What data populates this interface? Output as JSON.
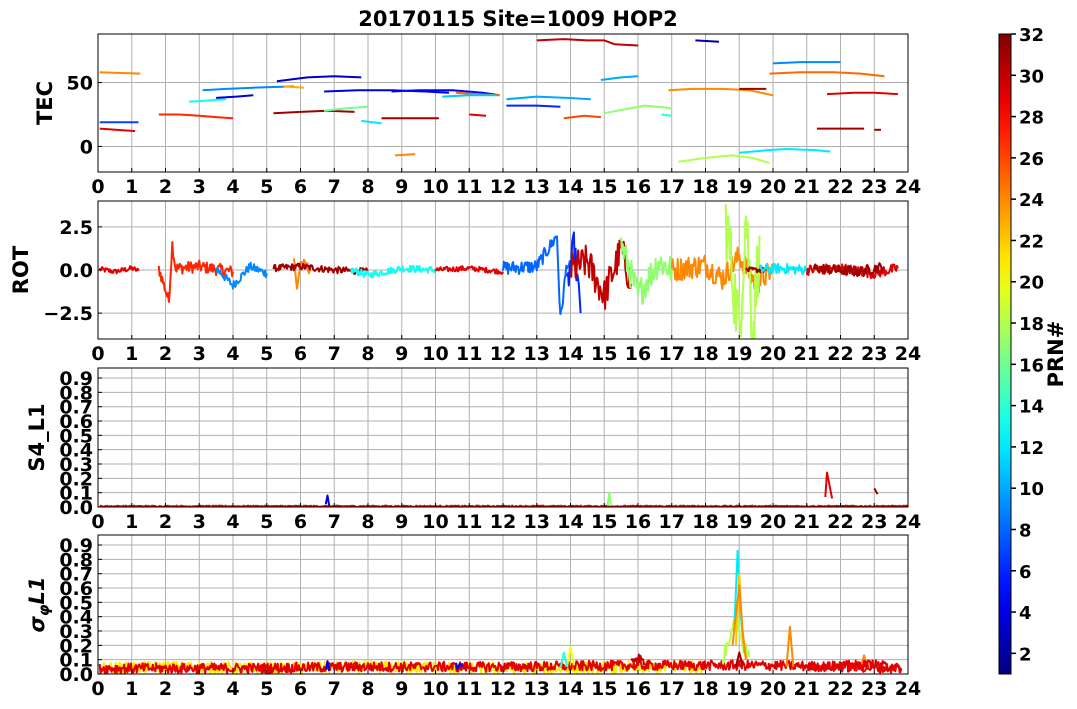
{
  "title": "20170115 Site=1009 HOP2",
  "colorbar": {
    "label": "PRN#",
    "colormap": "jet",
    "range": [
      1,
      32
    ],
    "ticks": [
      2,
      4,
      6,
      8,
      10,
      12,
      14,
      16,
      18,
      20,
      22,
      24,
      26,
      28,
      30,
      32
    ]
  },
  "chart_data": [
    {
      "type": "line",
      "ylabel": "TEC",
      "xlim": [
        0,
        24
      ],
      "ylim": [
        -20,
        88
      ],
      "xticks": [
        0,
        1,
        2,
        3,
        4,
        5,
        6,
        7,
        8,
        9,
        10,
        11,
        12,
        13,
        14,
        15,
        16,
        17,
        18,
        19,
        20,
        21,
        22,
        23,
        24
      ],
      "yticks": [
        0,
        50
      ],
      "grid": true,
      "series": [
        {
          "prn": 29,
          "x": [
            0.05,
            1.1
          ],
          "y": [
            14,
            12
          ]
        },
        {
          "prn": 7,
          "x": [
            0.05,
            1.2
          ],
          "y": [
            19,
            19
          ]
        },
        {
          "prn": 24,
          "x": [
            0.05,
            1.25
          ],
          "y": [
            58,
            57
          ]
        },
        {
          "prn": 27,
          "x": [
            1.8,
            2.4,
            3.0,
            3.5,
            4.0
          ],
          "y": [
            25,
            25,
            24,
            23,
            22
          ]
        },
        {
          "prn": 13,
          "x": [
            2.7,
            3.3,
            3.8
          ],
          "y": [
            35,
            36,
            37
          ]
        },
        {
          "prn": 9,
          "x": [
            3.1,
            3.8,
            4.6,
            5.8
          ],
          "y": [
            44,
            45,
            46,
            47
          ]
        },
        {
          "prn": 4,
          "x": [
            3.5,
            4.1,
            4.6
          ],
          "y": [
            38,
            39,
            40
          ]
        },
        {
          "prn": 3,
          "x": [
            5.3,
            6.2,
            7.0,
            7.8
          ],
          "y": [
            51,
            54,
            55,
            54
          ]
        },
        {
          "prn": 23,
          "x": [
            5.5,
            6.1
          ],
          "y": [
            47,
            46
          ]
        },
        {
          "prn": 31,
          "x": [
            5.2,
            6.0,
            6.8,
            7.6
          ],
          "y": [
            26,
            27,
            28,
            27
          ]
        },
        {
          "prn": 16,
          "x": [
            6.7,
            7.4,
            8.0
          ],
          "y": [
            28,
            30,
            31
          ]
        },
        {
          "prn": 4,
          "x": [
            6.7,
            7.7,
            8.7,
            9.7,
            10.4
          ],
          "y": [
            43,
            44,
            44,
            43,
            42
          ]
        },
        {
          "prn": 5,
          "x": [
            8.7,
            9.5,
            10.5,
            11.4,
            11.9
          ],
          "y": [
            43,
            44,
            44,
            42,
            40
          ]
        },
        {
          "prn": 12,
          "x": [
            7.8,
            8.4
          ],
          "y": [
            20,
            18
          ]
        },
        {
          "prn": 31,
          "x": [
            8.4,
            9.3,
            10.1
          ],
          "y": [
            22,
            22,
            22
          ]
        },
        {
          "prn": 24,
          "x": [
            8.8,
            9.4
          ],
          "y": [
            -7,
            -6
          ]
        },
        {
          "prn": 25,
          "x": [
            10.6,
            11.2,
            11.9
          ],
          "y": [
            42,
            41,
            40
          ]
        },
        {
          "prn": 11,
          "x": [
            10.2,
            11.0,
            11.8
          ],
          "y": [
            39,
            40,
            40
          ]
        },
        {
          "prn": 29,
          "x": [
            11.0,
            11.5
          ],
          "y": [
            25,
            24
          ]
        },
        {
          "prn": 6,
          "x": [
            12.1,
            13.0,
            13.7
          ],
          "y": [
            32,
            32,
            31
          ]
        },
        {
          "prn": 10,
          "x": [
            12.1,
            13.0,
            13.9,
            14.6
          ],
          "y": [
            37,
            39,
            38,
            37
          ]
        },
        {
          "prn": 30,
          "x": [
            13.0,
            13.8,
            14.5,
            15.0,
            15.3,
            16.0
          ],
          "y": [
            83,
            84,
            83,
            83,
            80,
            79
          ]
        },
        {
          "prn": 26,
          "x": [
            13.8,
            14.4,
            14.9
          ],
          "y": [
            22,
            24,
            23
          ]
        },
        {
          "prn": 10,
          "x": [
            14.9,
            15.5,
            16.0
          ],
          "y": [
            52,
            54,
            55
          ]
        },
        {
          "prn": 17,
          "x": [
            15.0,
            15.6,
            16.2,
            17.0
          ],
          "y": [
            26,
            29,
            32,
            30
          ]
        },
        {
          "prn": 14,
          "x": [
            16.7,
            17.0
          ],
          "y": [
            25,
            24
          ]
        },
        {
          "prn": 24,
          "x": [
            16.9,
            17.6,
            18.5,
            19.3,
            20.0
          ],
          "y": [
            44,
            45,
            45,
            44,
            40
          ]
        },
        {
          "prn": 2,
          "x": [
            17.7,
            18.4
          ],
          "y": [
            83,
            82
          ]
        },
        {
          "prn": 18,
          "x": [
            17.2,
            18.0,
            18.8,
            19.4,
            19.9
          ],
          "y": [
            -12,
            -9,
            -7,
            -9,
            -13
          ]
        },
        {
          "prn": 12,
          "x": [
            19.0,
            19.8,
            20.4,
            21.3,
            21.7
          ],
          "y": [
            -5,
            -3,
            -2,
            -3,
            -4
          ]
        },
        {
          "prn": 31,
          "x": [
            19.0,
            19.8
          ],
          "y": [
            45,
            45
          ]
        },
        {
          "prn": 25,
          "x": [
            19.9,
            20.8,
            21.8,
            22.6,
            23.3
          ],
          "y": [
            57,
            58,
            58,
            57,
            55
          ]
        },
        {
          "prn": 9,
          "x": [
            20.0,
            20.8,
            21.5,
            22.0
          ],
          "y": [
            65,
            66,
            66,
            66
          ]
        },
        {
          "prn": 29,
          "x": [
            21.6,
            22.4,
            23.0,
            23.7
          ],
          "y": [
            41,
            42,
            42,
            41
          ]
        },
        {
          "prn": 31,
          "x": [
            21.3,
            22.0,
            22.7
          ],
          "y": [
            14,
            14,
            14
          ]
        },
        {
          "prn": 31,
          "x": [
            23.0,
            23.2
          ],
          "y": [
            13,
            13
          ]
        }
      ]
    },
    {
      "type": "line",
      "ylabel": "ROT",
      "xlim": [
        0,
        24
      ],
      "ylim": [
        -4,
        4
      ],
      "xticks": [
        0,
        1,
        2,
        3,
        4,
        5,
        6,
        7,
        8,
        9,
        10,
        11,
        12,
        13,
        14,
        15,
        16,
        17,
        18,
        19,
        20,
        21,
        22,
        23,
        24
      ],
      "yticks": [
        -2.5,
        0.0,
        2.5
      ],
      "grid": true,
      "series": [
        {
          "prn": 29,
          "x": [
            0.05,
            0.5,
            1.0,
            1.2
          ],
          "y": [
            0.05,
            -0.1,
            0.1,
            -0.05
          ],
          "noise": 0.15
        },
        {
          "prn": 27,
          "x": [
            1.8,
            2.1,
            2.2,
            2.3,
            3.0,
            4.0
          ],
          "y": [
            0.1,
            -1.8,
            1.5,
            0.1,
            0.2,
            -0.1
          ],
          "noise": 0.35
        },
        {
          "prn": 9,
          "x": [
            3.5,
            4.0,
            4.5,
            5.0
          ],
          "y": [
            0.1,
            -0.9,
            0.2,
            -0.2
          ],
          "noise": 0.25
        },
        {
          "prn": 24,
          "x": [
            5.8,
            5.9,
            6.0,
            6.3
          ],
          "y": [
            0.9,
            -1.2,
            0.5,
            0.0
          ],
          "noise": 0.3
        },
        {
          "prn": 31,
          "x": [
            5.2,
            6.0,
            7.0,
            8.0
          ],
          "y": [
            0.1,
            0.2,
            0.0,
            -0.1
          ],
          "noise": 0.2
        },
        {
          "prn": 13,
          "x": [
            7.5,
            8.0,
            9.0,
            10.0
          ],
          "y": [
            0.0,
            -0.3,
            0.1,
            0.0
          ],
          "noise": 0.2
        },
        {
          "prn": 29,
          "x": [
            10.0,
            11.0,
            12.0
          ],
          "y": [
            0.0,
            0.1,
            -0.1
          ],
          "noise": 0.15
        },
        {
          "prn": 8,
          "x": [
            12.0,
            13.0,
            13.6,
            13.7,
            13.9,
            14.0
          ],
          "y": [
            0.1,
            0.2,
            2.0,
            -2.9,
            0.5,
            0.0
          ],
          "noise": 0.4
        },
        {
          "prn": 6,
          "x": [
            13.9,
            14.1,
            14.3
          ],
          "y": [
            -1.0,
            1.5,
            -2.5
          ],
          "noise": 0.8
        },
        {
          "prn": 30,
          "x": [
            14.0,
            14.5,
            15.0,
            15.5,
            15.8
          ],
          "y": [
            0.0,
            0.5,
            -1.5,
            1.2,
            -0.8
          ],
          "noise": 1.0
        },
        {
          "prn": 17,
          "x": [
            15.5,
            16.0,
            16.6,
            17.0
          ],
          "y": [
            1.5,
            -1.5,
            0.5,
            0.0
          ],
          "noise": 0.9
        },
        {
          "prn": 24,
          "x": [
            17.0,
            18.0,
            18.5,
            19.0,
            19.5,
            20.0
          ],
          "y": [
            0.0,
            0.3,
            -0.5,
            0.8,
            -0.8,
            0.0
          ],
          "noise": 0.7
        },
        {
          "prn": 18,
          "x": [
            18.6,
            19.0,
            19.2,
            19.4,
            19.6
          ],
          "y": [
            3.0,
            -3.5,
            3.5,
            -3.8,
            2.0
          ],
          "noise": 2.2
        },
        {
          "prn": 31,
          "x": [
            19.2,
            19.8
          ],
          "y": [
            0.0,
            0.0
          ],
          "noise": 0.15
        },
        {
          "prn": 12,
          "x": [
            19.6,
            20.2,
            21.0
          ],
          "y": [
            0.0,
            0.1,
            0.0
          ],
          "noise": 0.3
        },
        {
          "prn": 29,
          "x": [
            21.0,
            22.0,
            23.0,
            23.7
          ],
          "y": [
            0.0,
            0.1,
            -0.2,
            0.1
          ],
          "noise": 0.3
        },
        {
          "prn": 31,
          "x": [
            21.2,
            22.5,
            23.3
          ],
          "y": [
            0.1,
            -0.1,
            0.2
          ],
          "noise": 0.3
        }
      ]
    },
    {
      "type": "line",
      "ylabel": "S4_L1",
      "xlim": [
        0,
        24
      ],
      "ylim": [
        0,
        0.97
      ],
      "xticks": [
        0,
        1,
        2,
        3,
        4,
        5,
        6,
        7,
        8,
        9,
        10,
        11,
        12,
        13,
        14,
        15,
        16,
        17,
        18,
        19,
        20,
        21,
        22,
        23,
        24
      ],
      "yticks": [
        0.0,
        0.1,
        0.2,
        0.3,
        0.4,
        0.5,
        0.6,
        0.7,
        0.8,
        0.9
      ],
      "grid": true,
      "series": [
        {
          "prn": 29,
          "x": [
            0.05,
            24.0
          ],
          "y": [
            0.005,
            0.005
          ],
          "noise": 0.005
        },
        {
          "prn": 4,
          "x": [
            6.75,
            6.8,
            6.85
          ],
          "y": [
            0.02,
            0.08,
            0.01
          ]
        },
        {
          "prn": 17,
          "x": [
            15.1,
            15.15,
            15.2
          ],
          "y": [
            0.01,
            0.1,
            0.01
          ]
        },
        {
          "prn": 29,
          "x": [
            21.55,
            21.6,
            21.75
          ],
          "y": [
            0.07,
            0.24,
            0.06
          ]
        },
        {
          "prn": 31,
          "x": [
            23.0,
            23.1
          ],
          "y": [
            0.13,
            0.09
          ]
        }
      ]
    },
    {
      "type": "line",
      "ylabel": "σφL1",
      "xlim": [
        0,
        24
      ],
      "ylim": [
        0,
        0.97
      ],
      "xticks": [
        0,
        1,
        2,
        3,
        4,
        5,
        6,
        7,
        8,
        9,
        10,
        11,
        12,
        13,
        14,
        15,
        16,
        17,
        18,
        19,
        20,
        21,
        22,
        23,
        24
      ],
      "yticks": [
        0.0,
        0.1,
        0.2,
        0.3,
        0.4,
        0.5,
        0.6,
        0.7,
        0.8,
        0.9
      ],
      "grid": true,
      "series": [
        {
          "prn": 21,
          "x": [
            0.05,
            2.0,
            5.0,
            8.0,
            12.0,
            18.0
          ],
          "y": [
            0.04,
            0.05,
            0.04,
            0.05,
            0.04,
            0.05
          ],
          "noise": 0.04
        },
        {
          "prn": 29,
          "x": [
            0.05,
            4.0,
            8.0,
            12.0,
            16.0,
            20.0,
            23.8
          ],
          "y": [
            0.04,
            0.04,
            0.05,
            0.05,
            0.06,
            0.06,
            0.04
          ],
          "noise": 0.035
        },
        {
          "prn": 4,
          "x": [
            6.75,
            6.8,
            6.85
          ],
          "y": [
            0.03,
            0.09,
            0.02
          ]
        },
        {
          "prn": 5,
          "x": [
            10.6,
            10.8
          ],
          "y": [
            0.06,
            0.05
          ],
          "noise": 0.03
        },
        {
          "prn": 20,
          "x": [
            13.9,
            14.0,
            14.1
          ],
          "y": [
            0.05,
            0.19,
            0.06
          ]
        },
        {
          "prn": 14,
          "x": [
            13.7,
            13.8,
            13.9
          ],
          "y": [
            0.04,
            0.15,
            0.05
          ]
        },
        {
          "prn": 30,
          "x": [
            15.8,
            16.0,
            16.2
          ],
          "y": [
            0.1,
            0.12,
            0.08
          ],
          "noise": 0.03
        },
        {
          "prn": 18,
          "x": [
            18.5,
            18.7,
            18.9,
            19.1,
            19.3
          ],
          "y": [
            0.08,
            0.25,
            0.45,
            0.2,
            0.12
          ],
          "noise": 0.05
        },
        {
          "prn": 12,
          "x": [
            18.85,
            18.95,
            19.05,
            19.15
          ],
          "y": [
            0.3,
            0.86,
            0.4,
            0.15
          ]
        },
        {
          "prn": 22,
          "x": [
            18.9,
            19.0,
            19.1,
            19.2
          ],
          "y": [
            0.2,
            0.7,
            0.25,
            0.1
          ]
        },
        {
          "prn": 24,
          "x": [
            18.8,
            19.0,
            19.1,
            19.2
          ],
          "y": [
            0.2,
            0.62,
            0.3,
            0.1
          ]
        },
        {
          "prn": 24,
          "x": [
            20.4,
            20.5,
            20.6
          ],
          "y": [
            0.05,
            0.33,
            0.05
          ]
        },
        {
          "prn": 24,
          "x": [
            22.6,
            22.7,
            22.8
          ],
          "y": [
            0.05,
            0.13,
            0.04
          ]
        },
        {
          "prn": 31,
          "x": [
            18.9,
            19.0,
            19.1
          ],
          "y": [
            0.05,
            0.15,
            0.06
          ]
        },
        {
          "prn": 29,
          "x": [
            21.0,
            22.0,
            23.0,
            23.8
          ],
          "y": [
            0.05,
            0.06,
            0.07,
            0.04
          ],
          "noise": 0.03
        }
      ]
    }
  ]
}
